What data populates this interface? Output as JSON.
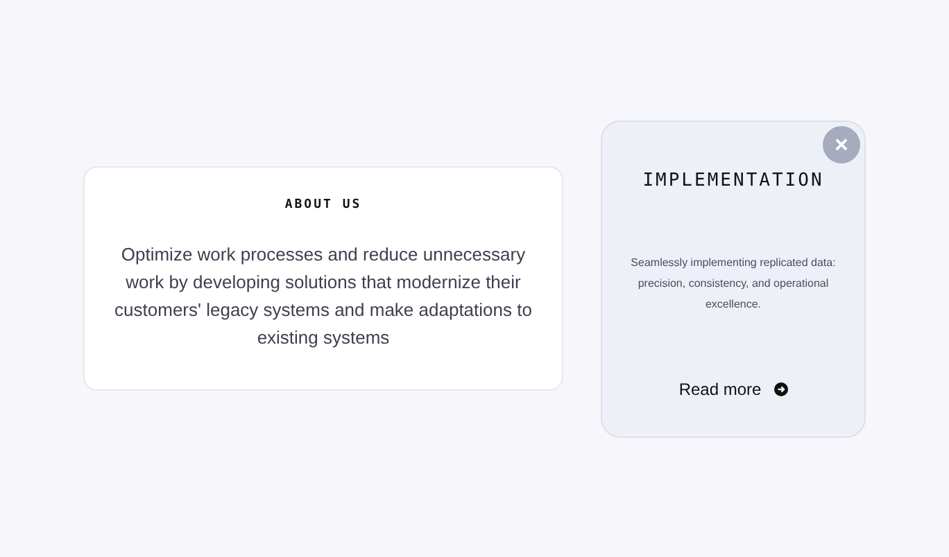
{
  "about": {
    "title": "ABOUT US",
    "text": "Optimize work processes and reduce unnecessary work by developing solutions that modernize their customers' legacy systems and make adaptations to existing systems"
  },
  "feature_card": {
    "title": "IMPLEMENTATION",
    "text": "Seamlessly implementing replicated data: precision, consistency, and operational excellence.",
    "link": "Read more",
    "close_button": "×"
  }
}
